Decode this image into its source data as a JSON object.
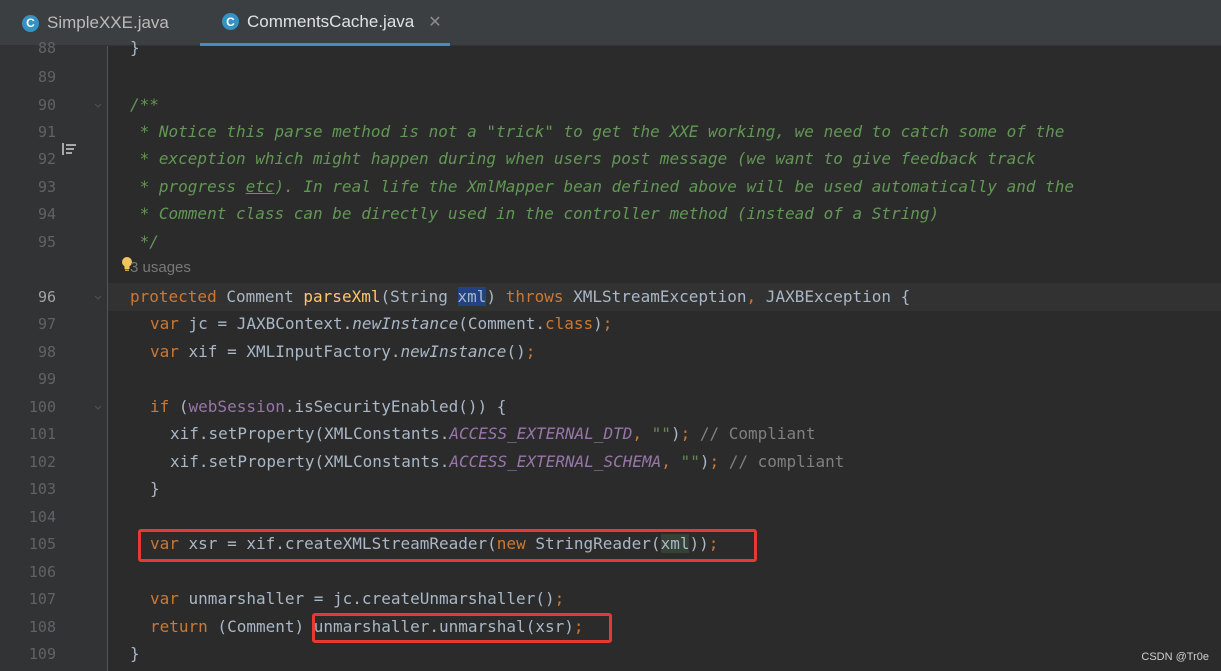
{
  "tabs": [
    {
      "label": "SimpleXXE.java",
      "icon": "class-icon",
      "icon_letter": "C",
      "active": false
    },
    {
      "label": "CommentsCache.java",
      "icon": "class-icon",
      "icon_letter": "C",
      "active": true,
      "close": "✕"
    }
  ],
  "line_numbers": [
    "88",
    "89",
    "90",
    "91",
    "92",
    "93",
    "94",
    "95",
    "96",
    "97",
    "98",
    "99",
    "100",
    "101",
    "102",
    "103",
    "104",
    "105",
    "106",
    "107",
    "108",
    "109"
  ],
  "usages": "3 usages",
  "code": {
    "l88": "}",
    "l90": "/**",
    "l91": " * Notice this parse method is not a \"trick\" to get the XXE working, we need to catch some of the",
    "l92": " * exception which might happen during when users post message (we want to give feedback track",
    "l93_a": " * progress ",
    "l93_b": "etc",
    "l93_c": "). In real life the XmlMapper bean defined above will be used automatically and the",
    "l94": " * Comment class can be directly used in the controller method (instead of a String)",
    "l95": " */",
    "l96_kw": "protected",
    "l96_a": " Comment ",
    "l96_fn": "parseXml",
    "l96_b": "(String ",
    "l96_sel": "xml",
    "l96_c": ") ",
    "l96_kw2": "throws",
    "l96_d": " XMLStreamException",
    "l96_comma": ",",
    "l96_e": " JAXBException {",
    "l97_kw": "var",
    "l97_a": " jc = JAXBContext.",
    "l97_it": "newInstance",
    "l97_b": "(Comment.",
    "l97_kw2": "class",
    "l97_c": ")",
    "l97_semi": ";",
    "l98_kw": "var",
    "l98_a": " xif = XMLInputFactory.",
    "l98_it": "newInstance",
    "l98_b": "()",
    "l98_semi": ";",
    "l100_kw": "if",
    "l100_a": " (",
    "l100_fld": "webSession",
    "l100_b": ".isSecurityEnabled()) {",
    "l101_a": "xif.setProperty(XMLConstants.",
    "l101_cst": "ACCESS_EXTERNAL_DTD",
    "l101_comma": ",",
    "l101_str": " \"\"",
    "l101_b": ")",
    "l101_semi": ";",
    "l101_cmt": " // Compliant",
    "l102_a": "xif.setProperty(XMLConstants.",
    "l102_cst": "ACCESS_EXTERNAL_SCHEMA",
    "l102_comma": ",",
    "l102_str": " \"\"",
    "l102_b": ")",
    "l102_semi": ";",
    "l102_cmt": " // compliant",
    "l103": "}",
    "l105_kw": "var",
    "l105_a": " xsr = xif.createXMLStreamReader(",
    "l105_kw2": "new",
    "l105_b": " StringReader(",
    "l105_hl": "xml",
    "l105_c": "))",
    "l105_semi": ";",
    "l107_kw": "var",
    "l107_a": " unmarshaller = jc.createUnmarshaller()",
    "l107_semi": ";",
    "l108_kw": "return",
    "l108_a": " (Comment) ",
    "l108_b": "unmarshaller.unmarshal(xsr)",
    "l108_semi": ";",
    "l109": "}"
  },
  "watermark": "CSDN @Tr0e",
  "colors": {
    "keyword": "#cc7832",
    "comment": "#629755",
    "method": "#ffc66d",
    "field": "#9876aa",
    "string": "#6a8759",
    "annotation_box": "#e53935"
  }
}
